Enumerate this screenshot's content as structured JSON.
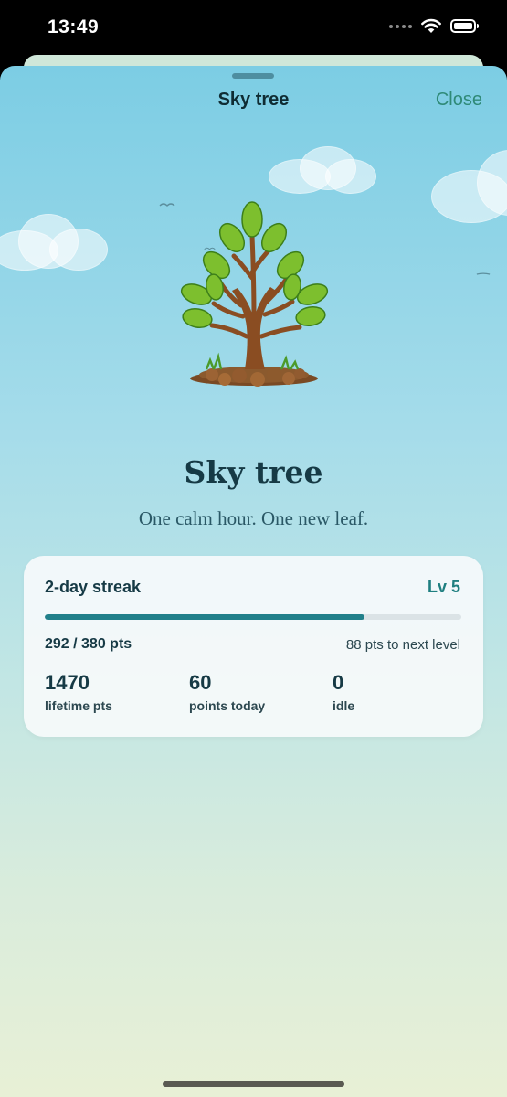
{
  "status_bar": {
    "time": "13:49"
  },
  "nav": {
    "title": "Sky tree",
    "close_label": "Close"
  },
  "hero": {
    "title": "Sky tree",
    "subtitle": "One calm hour. One new leaf."
  },
  "progress_card": {
    "streak": "2-day streak",
    "level": "Lv 5",
    "progress_fraction": 0.768,
    "points": "292 / 380 pts",
    "next_level": "88 pts to next level",
    "stats": [
      {
        "value": "1470",
        "label": "lifetime pts"
      },
      {
        "value": "60",
        "label": "points today"
      },
      {
        "value": "0",
        "label": "idle"
      }
    ]
  },
  "colors": {
    "accent": "#21808a",
    "close": "#2f8a77",
    "title": "#163a45"
  },
  "icons": [
    "wifi-icon",
    "battery-icon",
    "cellular-icon",
    "tree-icon",
    "cloud-icon",
    "bird-icon"
  ]
}
